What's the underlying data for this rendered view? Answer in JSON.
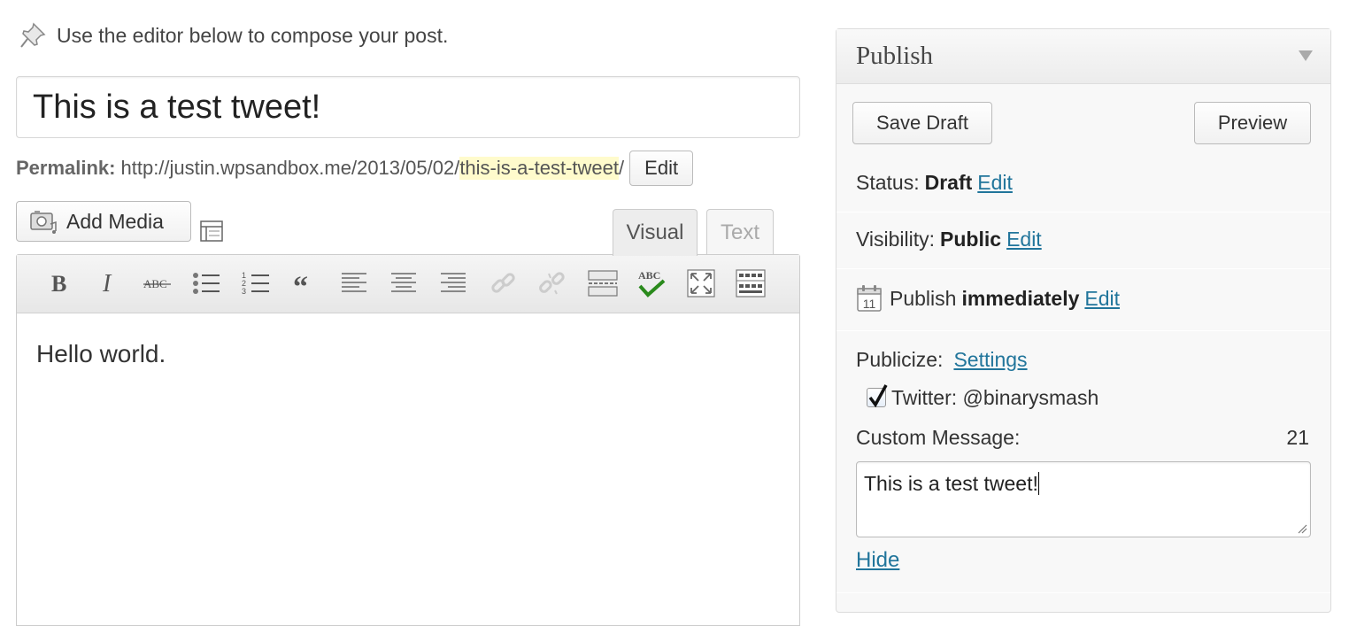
{
  "notice": {
    "text": "Use the editor below to compose your post.",
    "icon": "pushpin-icon"
  },
  "post": {
    "title": "This is a test tweet!",
    "permalink_label": "Permalink:",
    "permalink_base": "http://justin.wpsandbox.me/2013/05/02/",
    "permalink_slug": "this-is-a-test-tweet",
    "permalink_trailing": "/",
    "permalink_edit_label": "Edit"
  },
  "editor": {
    "add_media_label": "Add Media",
    "tabs": [
      {
        "label": "Visual",
        "active": true
      },
      {
        "label": "Text",
        "active": false
      }
    ],
    "toolbar": [
      "bold-icon",
      "italic-icon",
      "strikethrough-icon",
      "bullet-list-icon",
      "numbered-list-icon",
      "blockquote-icon",
      "align-left-icon",
      "align-center-icon",
      "align-right-icon",
      "insert-link-icon",
      "unlink-icon",
      "read-more-icon",
      "spellcheck-icon",
      "fullscreen-icon",
      "kitchen-sink-icon"
    ],
    "content": "Hello world."
  },
  "publish": {
    "title": "Publish",
    "save_draft_label": "Save Draft",
    "preview_label": "Preview",
    "status_label": "Status:",
    "status_value": "Draft",
    "visibility_label": "Visibility:",
    "visibility_value": "Public",
    "publish_label": "Publish",
    "publish_value": "immediately",
    "calendar_day": "11",
    "edit_label": "Edit",
    "publicize_label": "Publicize:",
    "settings_label": "Settings",
    "twitter_label": "Twitter: @binarysmash",
    "twitter_checked": true,
    "custom_message_label": "Custom Message:",
    "char_count": "21",
    "custom_message": "This is a test tweet!",
    "hide_label": "Hide"
  },
  "colors": {
    "link": "#21759b",
    "slug_highlight": "#fffbcc",
    "spellcheck_green": "#2a8a1c"
  }
}
